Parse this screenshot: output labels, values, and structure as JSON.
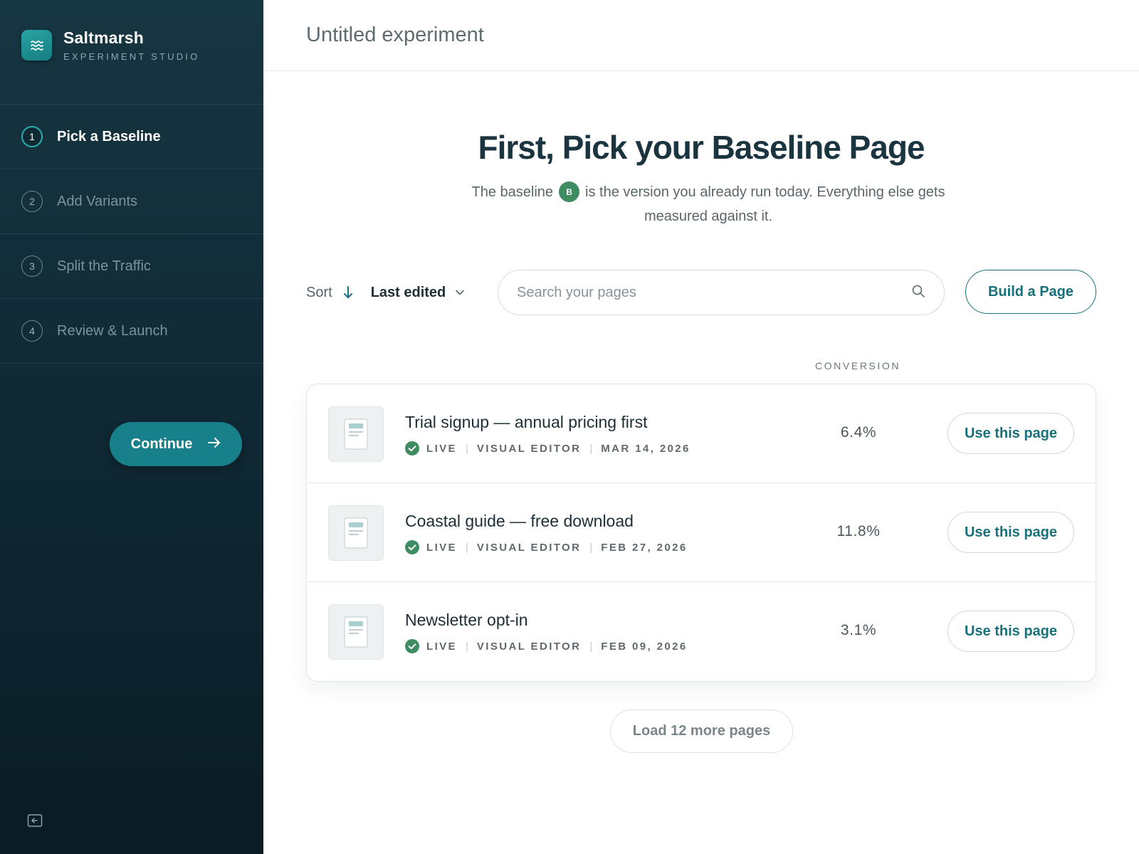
{
  "brand": {
    "name": "Saltmarsh",
    "subtitle": "EXPERIMENT STUDIO",
    "logo_icon": "waves-icon"
  },
  "steps": [
    {
      "number": "1",
      "label": "Pick a Baseline",
      "active": true
    },
    {
      "number": "2",
      "label": "Add Variants",
      "active": false
    },
    {
      "number": "3",
      "label": "Split the Traffic",
      "active": false
    },
    {
      "number": "4",
      "label": "Review & Launch",
      "active": false
    }
  ],
  "continue_label": "Continue",
  "header": {
    "title": "Untitled experiment"
  },
  "hero": {
    "title": "First, Pick your Baseline Page",
    "subtitle_before": "The baseline",
    "badge": "B",
    "subtitle_after": "is the version you already run today. Everything else gets measured against it."
  },
  "toolbar": {
    "sort_label": "Sort",
    "sort_value": "Last edited",
    "search_placeholder": "Search your pages",
    "build_label": "Build a Page"
  },
  "list": {
    "conversion_header": "CONVERSION",
    "rows": [
      {
        "title": "Trial signup — annual pricing first",
        "status": "LIVE",
        "editor": "VISUAL EDITOR",
        "date": "MAR 14, 2026",
        "conversion": "6.4%",
        "action": "Use this page"
      },
      {
        "title": "Coastal guide — free download",
        "status": "LIVE",
        "editor": "VISUAL EDITOR",
        "date": "FEB 27, 2026",
        "conversion": "11.8%",
        "action": "Use this page"
      },
      {
        "title": "Newsletter opt-in",
        "status": "LIVE",
        "editor": "VISUAL EDITOR",
        "date": "FEB 09, 2026",
        "conversion": "3.1%",
        "action": "Use this page"
      }
    ]
  },
  "load_more_label": "Load 12 more pages",
  "colors": {
    "accent": "#17808a",
    "sidebar": "#102a35",
    "live": "#3f8b62"
  }
}
